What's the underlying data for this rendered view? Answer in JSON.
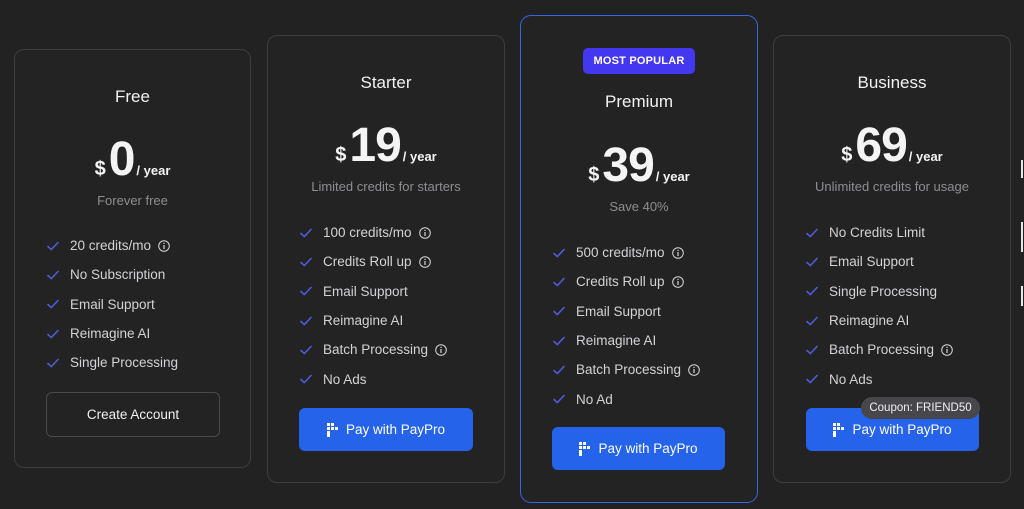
{
  "colors": {
    "background": "#222223",
    "card": "#232324",
    "accent_blue": "#2563eb",
    "featured_border": "#3466e8",
    "badge_purple": "#4338f0",
    "check_color": "#4e5bd8"
  },
  "plans": [
    {
      "name": "Free",
      "currency": "$",
      "price": "0",
      "period": "/ year",
      "subtitle": "Forever free",
      "features": [
        {
          "label": "20 credits/mo",
          "info": true
        },
        {
          "label": "No Subscription",
          "info": false
        },
        {
          "label": "Email Support",
          "info": false
        },
        {
          "label": "Reimagine AI",
          "info": false
        },
        {
          "label": "Single Processing",
          "info": false
        }
      ],
      "button_label": "Create Account"
    },
    {
      "name": "Starter",
      "currency": "$",
      "price": "19",
      "period": "/ year",
      "subtitle": "Limited credits for starters",
      "features": [
        {
          "label": "100 credits/mo",
          "info": true
        },
        {
          "label": "Credits Roll up",
          "info": true
        },
        {
          "label": "Email Support",
          "info": false
        },
        {
          "label": "Reimagine AI",
          "info": false
        },
        {
          "label": "Batch Processing",
          "info": true
        },
        {
          "label": "No Ads",
          "info": false
        }
      ],
      "button_label": "Pay with PayPro"
    },
    {
      "name": "Premium",
      "badge": "MOST POPULAR",
      "currency": "$",
      "price": "39",
      "period": "/ year",
      "subtitle": "Save 40%",
      "features": [
        {
          "label": "500 credits/mo",
          "info": true
        },
        {
          "label": "Credits Roll up",
          "info": true
        },
        {
          "label": "Email Support",
          "info": false
        },
        {
          "label": "Reimagine AI",
          "info": false
        },
        {
          "label": "Batch Processing",
          "info": true
        },
        {
          "label": "No Ad",
          "info": false
        }
      ],
      "button_label": "Pay with PayPro"
    },
    {
      "name": "Business",
      "currency": "$",
      "price": "69",
      "period": "/ year",
      "subtitle": "Unlimited credits for usage",
      "features": [
        {
          "label": "No Credits Limit",
          "info": false
        },
        {
          "label": "Email Support",
          "info": false
        },
        {
          "label": "Single Processing",
          "info": false
        },
        {
          "label": "Reimagine AI",
          "info": false
        },
        {
          "label": "Batch Processing",
          "info": true
        },
        {
          "label": "No Ads",
          "info": false
        }
      ],
      "button_label": "Pay with PayPro",
      "tooltip": "Coupon: FRIEND50"
    }
  ]
}
